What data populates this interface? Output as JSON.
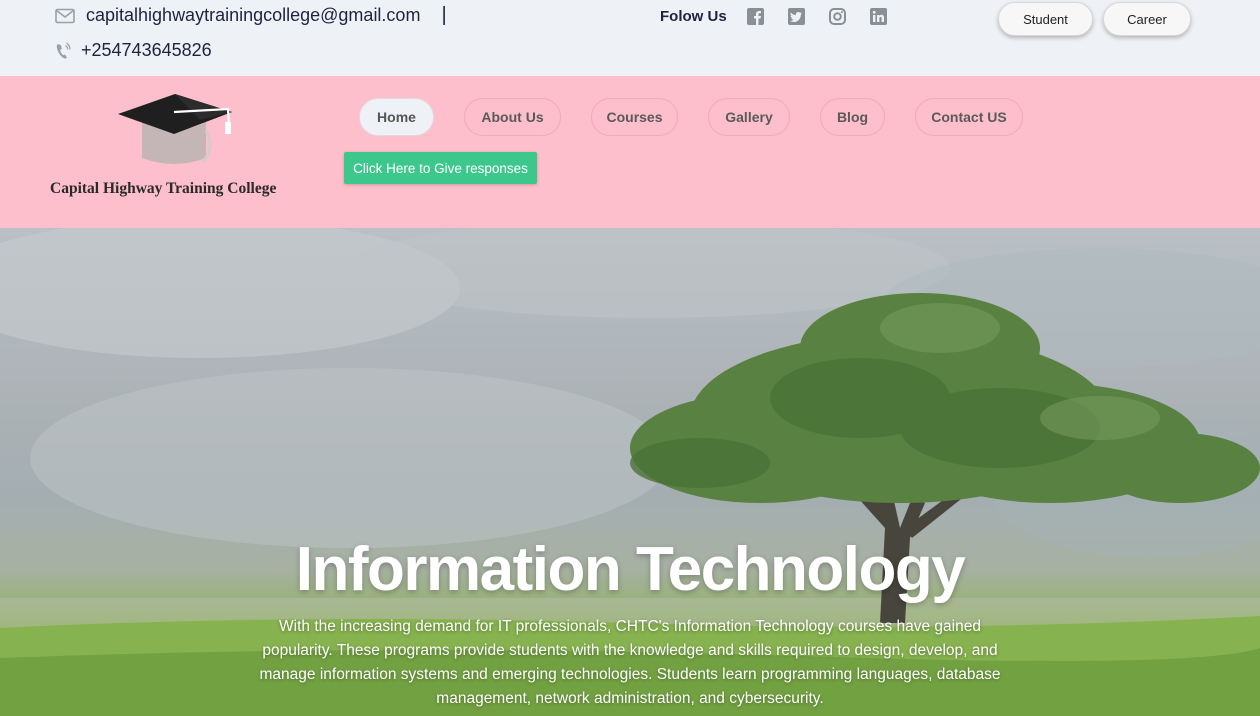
{
  "topbar": {
    "email": "capitalhighwaytrainingcollege@gmail.com",
    "separator": "|",
    "phone": "+254743645826",
    "follow_label": "Folow Us",
    "social": [
      "facebook-icon",
      "twitter-icon",
      "instagram-icon",
      "linkedin-icon"
    ],
    "student_button": "Student",
    "career_button": "Career"
  },
  "header": {
    "logo_text": "Capital Highway Training College",
    "nav": [
      {
        "label": "Home",
        "active": true
      },
      {
        "label": "About Us",
        "active": false
      },
      {
        "label": "Courses",
        "active": false
      },
      {
        "label": "Gallery",
        "active": false
      },
      {
        "label": "Blog",
        "active": false
      },
      {
        "label": "Contact US",
        "active": false
      }
    ],
    "cta_label": "Click Here to Give responses"
  },
  "hero": {
    "title": "Information Technology",
    "description": "With the increasing demand for IT professionals, CHTC's Information Technology courses have gained popularity. These programs provide students with the knowledge and skills required to design, develop, and manage information systems and emerging technologies. Students learn programming languages, database management, network administration, and cybersecurity."
  },
  "colors": {
    "topbar_bg": "#eef1f6",
    "header_bg": "#fdbfcc",
    "cta_bg": "#3ec78d",
    "text_dark": "#1e2340"
  }
}
